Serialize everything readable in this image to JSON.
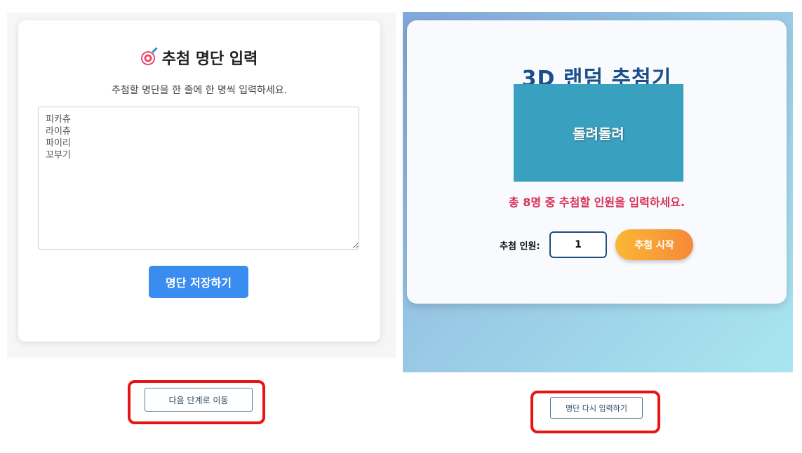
{
  "left": {
    "title": "추첨 명단 입력",
    "title_icon": "target-icon",
    "subtitle": "추첨할 명단을 한 줄에 한 명씩 입력하세요.",
    "names_value": "피카츄\n라이츄\n파이리\n꼬부기",
    "save_label": "명단 저장하기",
    "next_label": "다음 단계로 이동"
  },
  "right": {
    "title": "3D 랜덤 추첨기",
    "spin_text": "돌려돌려",
    "info": "총 8명 중 추첨할 인원을 입력하세요.",
    "count_label": "추첨 인원:",
    "count_value": "1",
    "start_label": "추첨 시작",
    "reenter_label": "명단 다시 입력하기"
  },
  "colors": {
    "save_button": "#3b8cf0",
    "title_blue": "#1a4f8b",
    "spin_box": "#3aa0bf",
    "info_text": "#d8335a",
    "start_gradient_from": "#fbb733",
    "start_gradient_to": "#f5893a",
    "highlight": "#e81414"
  }
}
